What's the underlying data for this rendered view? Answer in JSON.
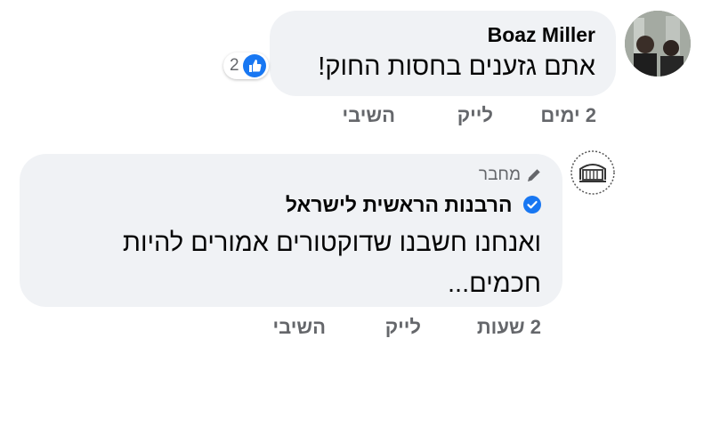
{
  "comments": [
    {
      "author": "Boaz Miller",
      "text": "אתם גזענים בחסות החוק!",
      "reaction_count": "2",
      "reaction_icon": "like-icon",
      "actions": {
        "time": "2 ימים",
        "like": "לייק",
        "reply": "השיבי"
      }
    },
    {
      "badge": "מחבר",
      "badge_icon": "pencil-icon",
      "author": "הרבנות הראשית לישראל",
      "verified_icon": "verified-badge-icon",
      "text": "ואנחנו חשבנו שדוקטורים אמורים להיות חכמים...",
      "actions": {
        "time": "2 שעות",
        "like": "לייק",
        "reply": "השיבי"
      }
    }
  ],
  "colors": {
    "bubble": "#f0f2f5",
    "accent": "#1877f2",
    "muted": "#65676b",
    "text": "#050505"
  }
}
